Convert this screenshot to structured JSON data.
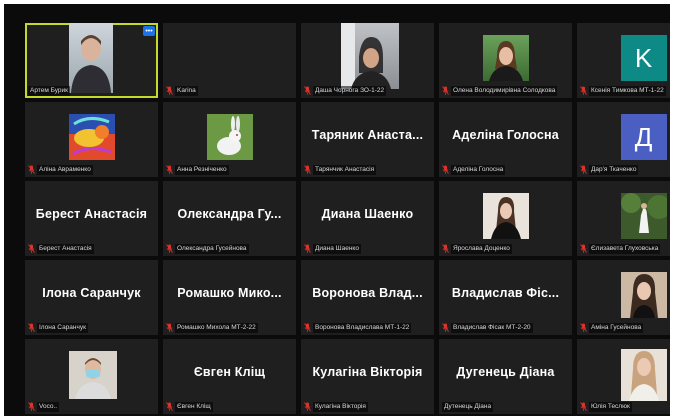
{
  "participants": [
    {
      "label": "Артем Бурик",
      "type": "video",
      "active": true,
      "muted": false,
      "more_icon": "•••"
    },
    {
      "label": "Karina",
      "type": "empty"
    },
    {
      "label": "Даша Чорнога ЗО-1-22",
      "type": "video"
    },
    {
      "label": "Олена Володимирівна Солодкова",
      "type": "video"
    },
    {
      "label": "Ксенія Тимкова МТ-1-22",
      "type": "letter",
      "letter": "K",
      "color": "#0e8a86"
    },
    {
      "label": "Аліна Авраменко",
      "type": "artwork"
    },
    {
      "label": "Анна Резніченко",
      "type": "rabbit"
    },
    {
      "label": "Тарянчик Анастасія",
      "type": "name",
      "name": "Таряник Анаста..."
    },
    {
      "label": "Аделіна Голосна",
      "type": "name",
      "name": "Аделіна Голосна"
    },
    {
      "label": "Дар'я Ткаченко",
      "type": "letter",
      "letter": "Д",
      "color": "#4a5fc1"
    },
    {
      "label": "Берест Анастасія",
      "type": "name",
      "name": "Берест Анастасія"
    },
    {
      "label": "Олександра Гусейнова",
      "type": "name",
      "name": "Олександра Гу..."
    },
    {
      "label": "Диана Шаенко",
      "type": "name",
      "name": "Диана Шаенко"
    },
    {
      "label": "Ярослава Доценко",
      "type": "video"
    },
    {
      "label": "Єлизавета Глуховська",
      "type": "forest"
    },
    {
      "label": "Ілона Саранчук",
      "type": "name",
      "name": "Ілона Саранчук"
    },
    {
      "label": "Ромашко Михола МТ-2-22",
      "type": "name",
      "name": "Ромашко Мико..."
    },
    {
      "label": "Воронова Владислава МТ-1-22",
      "type": "name",
      "name": "Воронова Влад..."
    },
    {
      "label": "Владислав Фісак МТ-2-20",
      "type": "name",
      "name": "Владислав Фіс..."
    },
    {
      "label": "Аміна Гусейнова",
      "type": "video"
    },
    {
      "label": "Voco..",
      "type": "video"
    },
    {
      "label": "Євген Кліщ",
      "type": "name",
      "name": "Євген Кліщ"
    },
    {
      "label": "Кулагіна Вікторія",
      "type": "name",
      "name": "Кулагіна Вікторія"
    },
    {
      "label": "Дутенець Діана",
      "type": "name",
      "name": "Дугенець Діана",
      "nomic": true
    },
    {
      "label": "Юлія Теслюк",
      "type": "video"
    }
  ],
  "icons": {
    "muted_mic": "muted-mic-icon",
    "avatar": "avatar-photo"
  },
  "colors": {
    "active_border": "#c6d92b",
    "muted_icon": "#e0322b",
    "tile_bg": "#1f1f1f"
  }
}
